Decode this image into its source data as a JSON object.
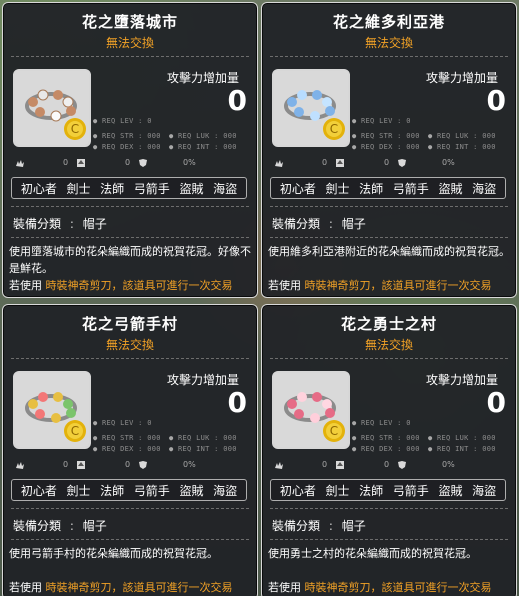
{
  "cards": [
    {
      "title": "花之墮落城市",
      "subtitle": "無法交換",
      "attack_label": "攻擊力增加量",
      "attack_value": "0",
      "req": {
        "lev": "REQ LEV :",
        "lev_val": "0",
        "str": "REQ STR :",
        "str_val": "000",
        "luk": "REQ LUK :",
        "luk_val": "000",
        "dex": "REQ DEX :",
        "dex_val": "000",
        "int": "REQ INT :",
        "int_val": "000"
      },
      "status": [
        "0",
        "0",
        "0%"
      ],
      "jobs": [
        "初心者",
        "劍士",
        "法師",
        "弓箭手",
        "盜賊",
        "海盜"
      ],
      "type_label": "裝備分類",
      "type_value": "帽子",
      "description": "使用墮落城市的花朵編織而成的祝賀花冠。好像不是鮮花。",
      "notice_prefix": "若使用",
      "notice_text": "時裝神奇剪刀，該道具可進行一次交易",
      "icon_color": "#c58a66"
    },
    {
      "title": "花之維多利亞港",
      "subtitle": "無法交換",
      "attack_label": "攻擊力增加量",
      "attack_value": "0",
      "req": {
        "lev": "REQ LEV :",
        "lev_val": "0",
        "str": "REQ STR :",
        "str_val": "000",
        "luk": "REQ LUK :",
        "luk_val": "000",
        "dex": "REQ DEX :",
        "dex_val": "000",
        "int": "REQ INT :",
        "int_val": "000"
      },
      "status": [
        "0",
        "0",
        "0%"
      ],
      "jobs": [
        "初心者",
        "劍士",
        "法師",
        "弓箭手",
        "盜賊",
        "海盜"
      ],
      "type_label": "裝備分類",
      "type_value": "帽子",
      "description": "使用維多利亞港附近的花朵編織而成的祝賀花冠。",
      "notice_prefix": "若使用",
      "notice_text": "時裝神奇剪刀，該道具可進行一次交易",
      "icon_color": "#7fb2e8"
    },
    {
      "title": "花之弓箭手村",
      "subtitle": "無法交換",
      "attack_label": "攻擊力增加量",
      "attack_value": "0",
      "req": {
        "lev": "REQ LEV :",
        "lev_val": "0",
        "str": "REQ STR :",
        "str_val": "000",
        "luk": "REQ LUK :",
        "luk_val": "000",
        "dex": "REQ DEX :",
        "dex_val": "000",
        "int": "REQ INT :",
        "int_val": "000"
      },
      "status": [
        "0",
        "0",
        "0%"
      ],
      "jobs": [
        "初心者",
        "劍士",
        "法師",
        "弓箭手",
        "盜賊",
        "海盜"
      ],
      "type_label": "裝備分類",
      "type_value": "帽子",
      "description": "使用弓箭手村的花朵編織而成的祝賀花冠。",
      "notice_prefix": "若使用",
      "notice_text": "時裝神奇剪刀，該道具可進行一次交易",
      "icon_color": "#e7bf42"
    },
    {
      "title": "花之勇士之村",
      "subtitle": "無法交換",
      "attack_label": "攻擊力增加量",
      "attack_value": "0",
      "req": {
        "lev": "REQ LEV :",
        "lev_val": "0",
        "str": "REQ STR :",
        "str_val": "000",
        "luk": "REQ LUK :",
        "luk_val": "000",
        "dex": "REQ DEX :",
        "dex_val": "000",
        "int": "REQ INT :",
        "int_val": "000"
      },
      "status": [
        "0",
        "0",
        "0%"
      ],
      "jobs": [
        "初心者",
        "劍士",
        "法師",
        "弓箭手",
        "盜賊",
        "海盜"
      ],
      "type_label": "裝備分類",
      "type_value": "帽子",
      "description": "使用勇士之村的花朵編織而成的祝賀花冠。",
      "notice_prefix": "若使用",
      "notice_text": "時裝神奇剪刀，該道具可進行一次交易",
      "icon_color": "#e66b86"
    }
  ]
}
